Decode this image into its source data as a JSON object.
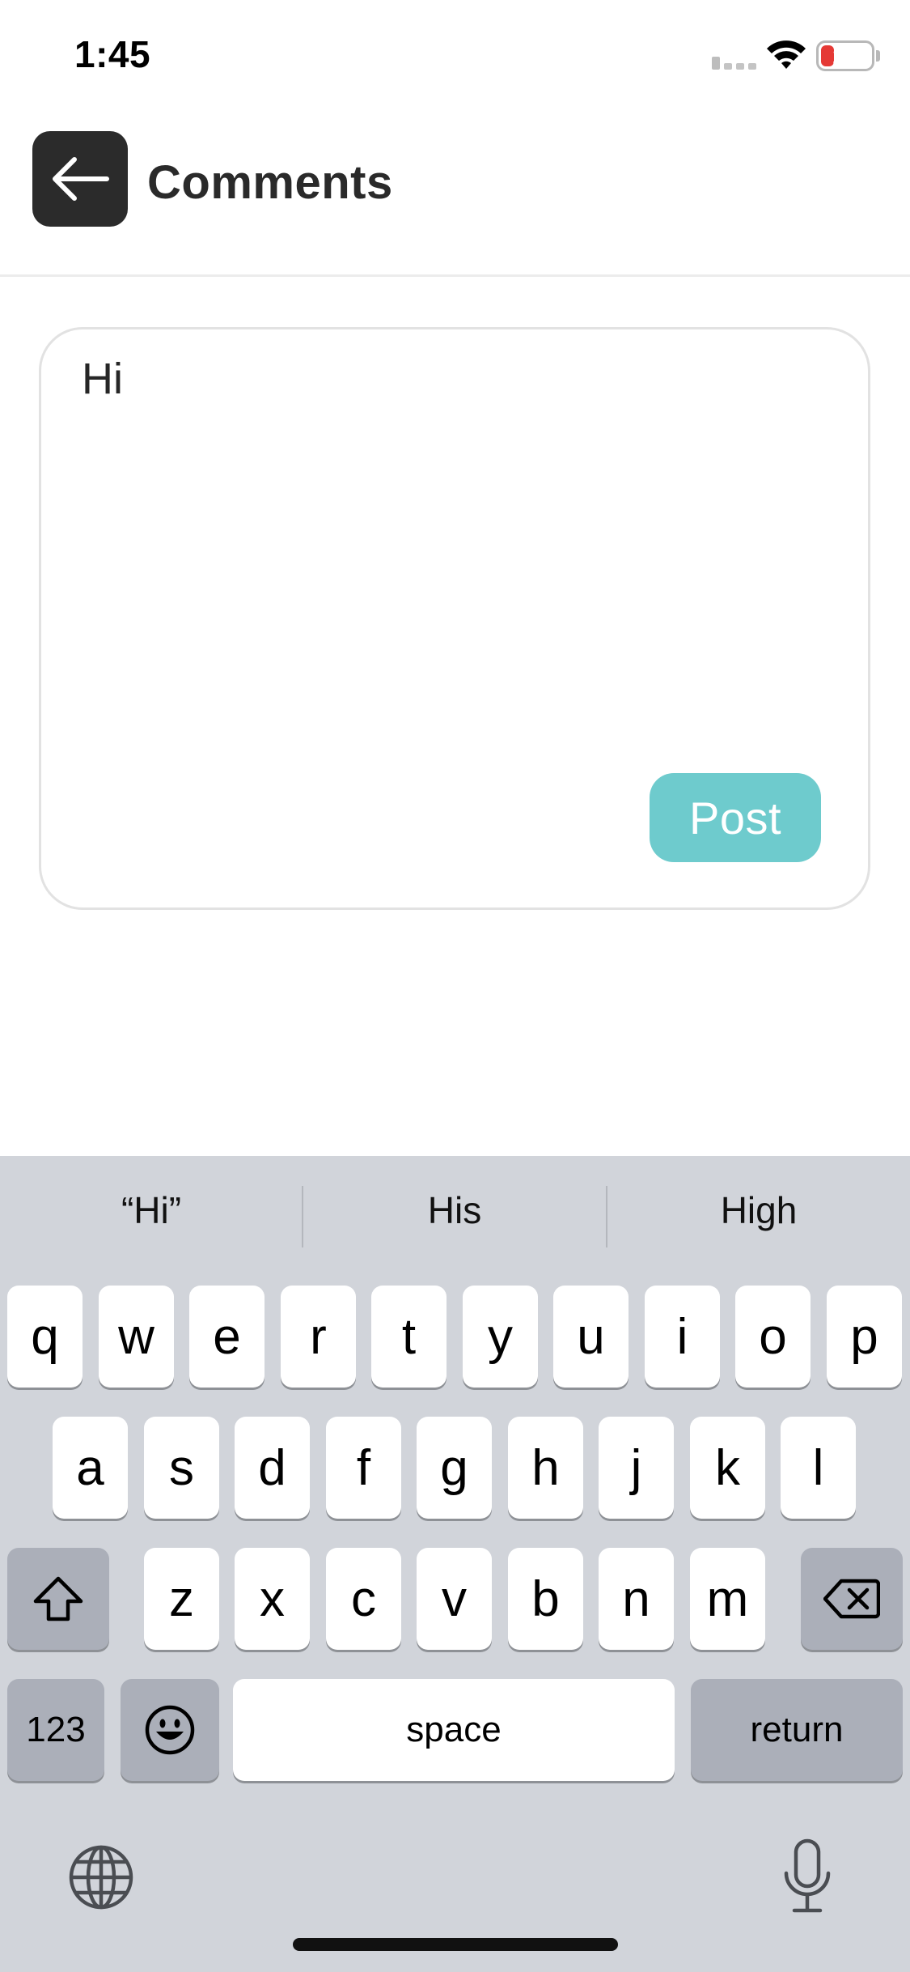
{
  "status_bar": {
    "time": "1:45",
    "battery_level": "20",
    "icons": [
      "signal-icon",
      "wifi-icon",
      "battery-icon"
    ]
  },
  "header": {
    "title": "Comments",
    "back_icon": "arrow-left-icon"
  },
  "comment": {
    "text": "Hi",
    "post_label": "Post"
  },
  "keyboard": {
    "suggestions": [
      "“Hi”",
      "His",
      "High"
    ],
    "row1": [
      "q",
      "w",
      "e",
      "r",
      "t",
      "y",
      "u",
      "i",
      "o",
      "p"
    ],
    "row2": [
      "a",
      "s",
      "d",
      "f",
      "g",
      "h",
      "j",
      "k",
      "l"
    ],
    "row3": [
      "z",
      "x",
      "c",
      "v",
      "b",
      "n",
      "m"
    ],
    "numbers_label": "123",
    "space_label": "space",
    "return_label": "return",
    "icons": [
      "shift-icon",
      "delete-icon",
      "emoji-icon",
      "globe-icon",
      "microphone-icon"
    ]
  },
  "colors": {
    "accent": "#6ecbcd",
    "header_button": "#2b2b2b",
    "keyboard_bg": "#d1d4da",
    "battery_low": "#e53935"
  }
}
